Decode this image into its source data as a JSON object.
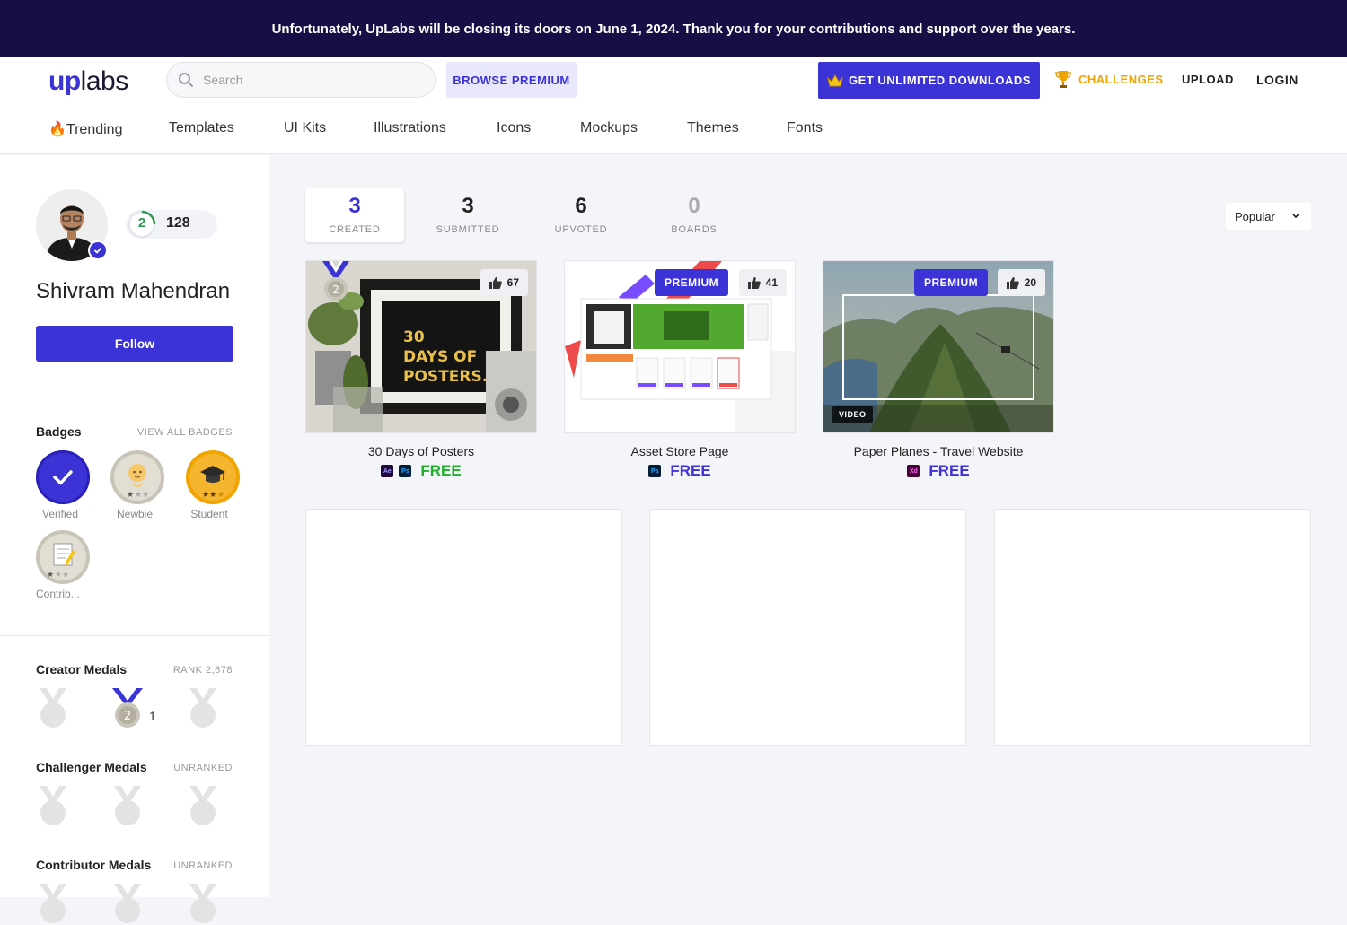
{
  "banner": {
    "text": "Unfortunately, UpLabs will be closing its doors on June 1, 2024. Thank you for your contributions and support over the years."
  },
  "header": {
    "logo_up": "up",
    "logo_labs": "labs",
    "search_placeholder": "Search",
    "browse_premium": "BROWSE PREMIUM",
    "unlimited_downloads": "GET UNLIMITED DOWNLOADS",
    "challenges": "CHALLENGES",
    "upload": "UPLOAD",
    "login": "LOGIN"
  },
  "categories": [
    {
      "label": "🔥Trending"
    },
    {
      "label": "Templates"
    },
    {
      "label": "UI Kits"
    },
    {
      "label": "Illustrations"
    },
    {
      "label": "Icons"
    },
    {
      "label": "Mockups"
    },
    {
      "label": "Themes"
    },
    {
      "label": "Fonts"
    }
  ],
  "profile": {
    "name": "Shivram Mahendran",
    "level": "2",
    "points": "128",
    "follow_label": "Follow"
  },
  "badges": {
    "title": "Badges",
    "view_all": "VIEW ALL BADGES",
    "items": [
      {
        "label": "Verified",
        "icon": "check-icon"
      },
      {
        "label": "Newbie",
        "icon": "baby-icon"
      },
      {
        "label": "Student",
        "icon": "graduation-cap-icon"
      },
      {
        "label": "Contrib...",
        "icon": "memo-icon"
      }
    ]
  },
  "medals": {
    "creator": {
      "title": "Creator Medals",
      "rank": "RANK 2,678",
      "silver_count": "1",
      "silver_number": "2"
    },
    "challenger": {
      "title": "Challenger Medals",
      "rank": "UNRANKED"
    },
    "contributor": {
      "title": "Contributor Medals",
      "rank": "UNRANKED"
    }
  },
  "tabs": [
    {
      "num": "3",
      "label": "CREATED",
      "active": true
    },
    {
      "num": "3",
      "label": "SUBMITTED"
    },
    {
      "num": "6",
      "label": "UPVOTED"
    },
    {
      "num": "0",
      "label": "BOARDS"
    }
  ],
  "sort": {
    "value": "Popular"
  },
  "cards": [
    {
      "title": "30 Days of Posters",
      "likes": "67",
      "price": "FREE",
      "tools": [
        "Ae",
        "Ps"
      ],
      "poster_text": "30 DAYS OF POSTERS.",
      "medal_number": "2"
    },
    {
      "title": "Asset Store Page",
      "likes": "41",
      "price": "FREE",
      "tools": [
        "Ps"
      ],
      "premium": "PREMIUM"
    },
    {
      "title": "Paper Planes - Travel Website",
      "likes": "20",
      "price": "FREE",
      "tools": [
        "Xd"
      ],
      "premium": "PREMIUM",
      "video": "VIDEO"
    }
  ],
  "colors": {
    "accent": "#3b33d6",
    "banner_bg": "#170e46",
    "free_green": "#1fae2b",
    "challenges_gold": "#f0a400"
  }
}
